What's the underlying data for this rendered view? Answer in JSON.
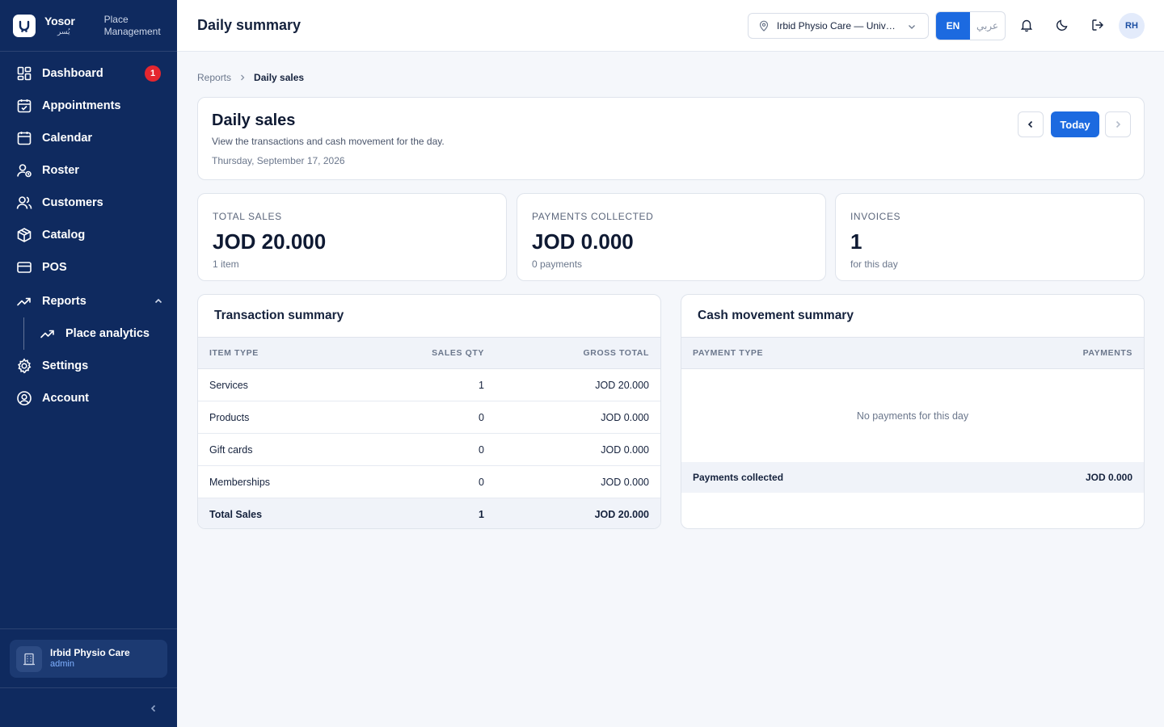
{
  "brand": {
    "name": "Yosor",
    "name_ar": "يُسر",
    "subtitle_line1": "Place",
    "subtitle_line2": "Management"
  },
  "sidebar": {
    "items": [
      {
        "label": "Dashboard",
        "icon": "dashboard-icon",
        "badge": "1"
      },
      {
        "label": "Appointments",
        "icon": "calendar-check-icon"
      },
      {
        "label": "Calendar",
        "icon": "calendar-icon"
      },
      {
        "label": "Roster",
        "icon": "user-clock-icon"
      },
      {
        "label": "Customers",
        "icon": "users-icon"
      },
      {
        "label": "Catalog",
        "icon": "box-icon"
      },
      {
        "label": "POS",
        "icon": "credit-card-icon"
      },
      {
        "label": "Reports",
        "icon": "trending-up-icon",
        "expanded": true
      },
      {
        "label": "Settings",
        "icon": "gear-icon"
      },
      {
        "label": "Account",
        "icon": "user-circle-icon"
      }
    ],
    "sub_items": [
      {
        "label": "Place analytics",
        "icon": "trending-up-icon"
      }
    ],
    "footer": {
      "place_name": "Irbid Physio Care",
      "role": "admin"
    }
  },
  "topbar": {
    "title": "Daily summary",
    "place_select": "Irbid Physio Care — University Street",
    "lang_en": "EN",
    "lang_ar": "عربي",
    "avatar_initials": "RH"
  },
  "breadcrumb": {
    "parent": "Reports",
    "current": "Daily sales"
  },
  "header": {
    "title": "Daily sales",
    "description": "View the transactions and cash movement for the day.",
    "date": "Thursday, September 17, 2026",
    "today_label": "Today"
  },
  "stats": [
    {
      "label": "TOTAL SALES",
      "value": "JOD 20.000",
      "sub": "1 item"
    },
    {
      "label": "PAYMENTS COLLECTED",
      "value": "JOD 0.000",
      "sub": "0 payments"
    },
    {
      "label": "INVOICES",
      "value": "1",
      "sub": "for this day"
    }
  ],
  "transaction_summary": {
    "title": "Transaction summary",
    "columns": [
      "ITEM TYPE",
      "SALES QTY",
      "GROSS TOTAL"
    ],
    "rows": [
      {
        "type": "Services",
        "qty": "1",
        "total": "JOD 20.000"
      },
      {
        "type": "Products",
        "qty": "0",
        "total": "JOD 0.000"
      },
      {
        "type": "Gift cards",
        "qty": "0",
        "total": "JOD 0.000"
      },
      {
        "type": "Memberships",
        "qty": "0",
        "total": "JOD 0.000"
      }
    ],
    "total_row": {
      "type": "Total Sales",
      "qty": "1",
      "total": "JOD 20.000"
    }
  },
  "cash_summary": {
    "title": "Cash movement summary",
    "columns": [
      "PAYMENT TYPE",
      "PAYMENTS"
    ],
    "empty_text": "No payments for this day",
    "total_label": "Payments collected",
    "total_value": "JOD 0.000"
  },
  "colors": {
    "sidebar": "#0f2a5f",
    "accent": "#1c6ae0",
    "badge": "#e5262f"
  }
}
